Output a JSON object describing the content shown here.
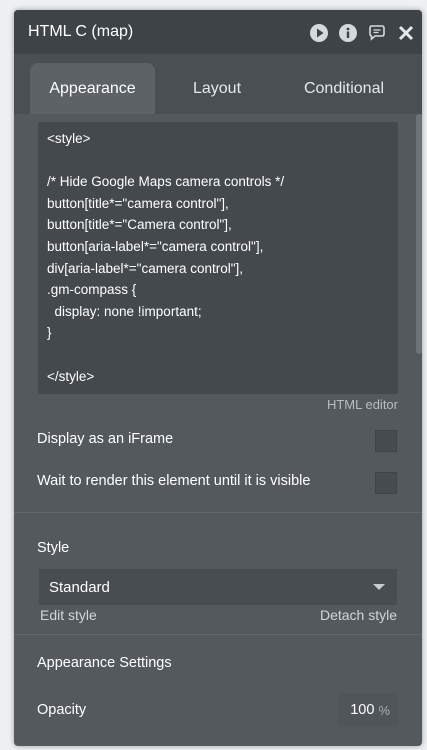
{
  "header": {
    "title": "HTML C (map)",
    "icons": [
      "play-icon",
      "info-icon",
      "comment-icon",
      "close-icon"
    ]
  },
  "tabs": [
    {
      "label": "Appearance",
      "active": true
    },
    {
      "label": "Layout",
      "active": false
    },
    {
      "label": "Conditional",
      "active": false
    }
  ],
  "editor": {
    "code": "<style>\n\n/* Hide Google Maps camera controls */\nbutton[title*=\"camera control\"],\nbutton[title*=\"Camera control\"],\nbutton[aria-label*=\"camera control\"],\ndiv[aria-label*=\"camera control\"],\n.gm-compass {\n  display: none !important;\n}\n\n</style>",
    "caption": "HTML editor"
  },
  "options": {
    "iframe_label": "Display as an iFrame",
    "iframe_checked": false,
    "wait_label": "Wait to render this element until it is visible",
    "wait_checked": false
  },
  "style": {
    "heading": "Style",
    "selected": "Standard",
    "edit_link": "Edit style",
    "detach_link": "Detach style"
  },
  "appearance_settings": {
    "heading": "Appearance Settings",
    "opacity_label": "Opacity",
    "opacity_value": "100",
    "opacity_unit": "%"
  },
  "colors": {
    "panel_bg": "#54595e",
    "titlebar_bg": "#3e4347",
    "editor_bg": "#44494d"
  }
}
